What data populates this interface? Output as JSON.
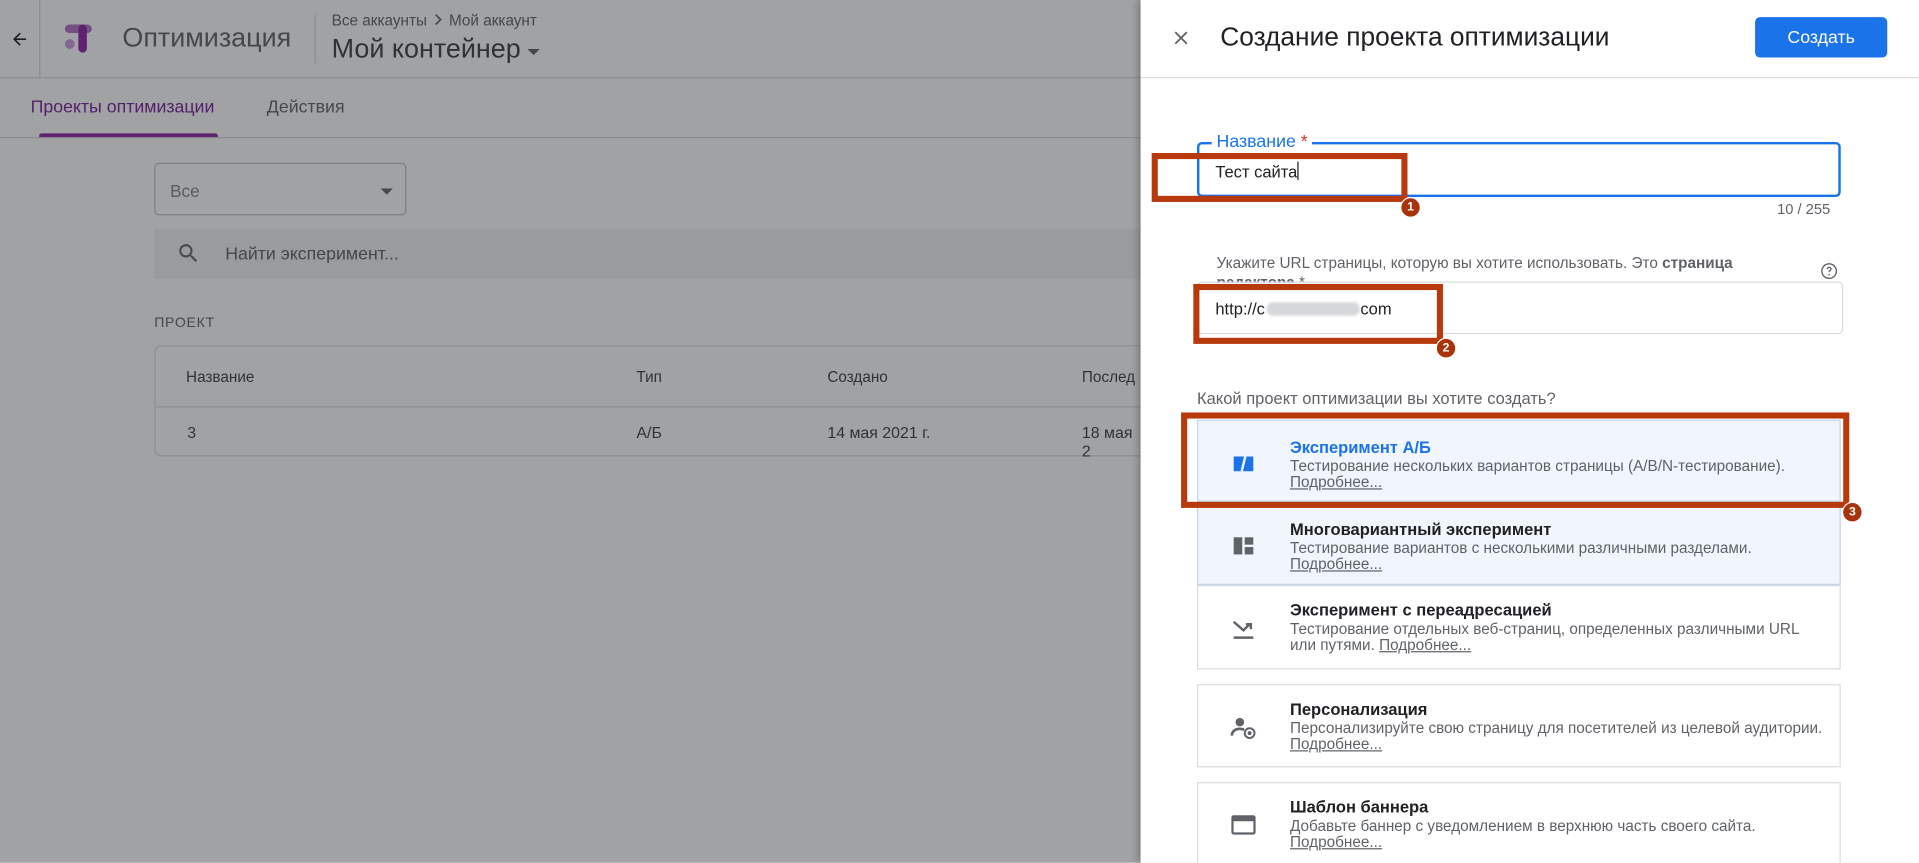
{
  "app": {
    "product_name": "Оптимизация",
    "breadcrumb": [
      "Все аккаунты",
      "Мой аккаунт"
    ],
    "container_name": "Мой контейнер",
    "tabs": [
      {
        "label": "Проекты оптимизации",
        "active": true
      },
      {
        "label": "Действия",
        "active": false
      }
    ],
    "filter": {
      "value": "Все"
    },
    "search": {
      "placeholder": "Найти эксперимент..."
    },
    "section_label": "ПРОЕКТ",
    "table": {
      "columns": [
        "Название",
        "Тип",
        "Создано",
        "Послед"
      ],
      "rows": [
        [
          "3",
          "А/Б",
          "14 мая 2021 г.",
          "18 мая 2"
        ]
      ]
    }
  },
  "panel": {
    "title": "Создание проекта оптимизации",
    "create_label": "Создать",
    "name_field": {
      "label": "Название",
      "required_mark": "*",
      "value": "Тест сайта",
      "counter": "10 / 255"
    },
    "url_field": {
      "hint": "Укажите URL страницы, которую вы хотите использовать. Это",
      "hint_bold": "страница редактора",
      "required_mark": "*",
      "value_prefix": "http://c",
      "value_suffix": "com"
    },
    "question": "Какой проект оптимизации вы хотите создать?",
    "options": [
      {
        "title": "Эксперимент А/Б",
        "desc": "Тестирование нескольких вариантов страницы (A/B/N-тестирование).",
        "more": "Подробнее...",
        "icon": "ab-split-icon",
        "selected": true
      },
      {
        "title": "Многовариантный эксперимент",
        "desc": "Тестирование вариантов с несколькими различными разделами.",
        "more": "Подробнее...",
        "icon": "dashboard-grid-icon",
        "selected": false
      },
      {
        "title": "Эксперимент с переадресацией",
        "desc": "Тестирование отдельных веб-страниц, определенных различными URL или путями.",
        "more": "Подробнее...",
        "icon": "redirect-arrow-icon",
        "selected": false
      },
      {
        "title": "Персонализация",
        "desc": "Персонализируйте свою страницу для посетителей из целевой аудитории.",
        "more": "Подробнее...",
        "icon": "person-target-icon",
        "selected": false
      },
      {
        "title": "Шаблон баннера",
        "desc": "Добавьте баннер с уведомлением в верхнюю часть своего сайта.",
        "more": "Подробнее...",
        "icon": "banner-window-icon",
        "selected": false
      }
    ]
  },
  "annotations": [
    "1",
    "2",
    "3"
  ],
  "colors": {
    "accent_blue": "#1a73e8",
    "accent_purple": "#8e24aa",
    "annotation_red": "#b83a0c"
  }
}
